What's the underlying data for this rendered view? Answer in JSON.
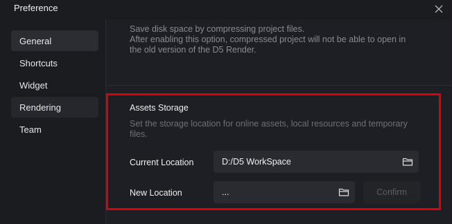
{
  "window": {
    "title": "Preference"
  },
  "sidebar": {
    "items": [
      {
        "label": "General"
      },
      {
        "label": "Shortcuts"
      },
      {
        "label": "Widget"
      },
      {
        "label": "Rendering"
      },
      {
        "label": "Team"
      }
    ]
  },
  "compression": {
    "desc_line1": "Save disk space by compressing project files.",
    "desc_line2": "After enabling this option, compressed project will not be able to open in",
    "desc_line3": "the old version of the D5 Render."
  },
  "assets_storage": {
    "title": "Assets Storage",
    "description": "Set the storage location for online assets, local resources and temporary files.",
    "current_location_label": "Current Location",
    "current_location_value": "D:/D5 WorkSpace",
    "new_location_label": "New Location",
    "new_location_value": "...",
    "confirm_label": "Confirm"
  },
  "colors": {
    "highlight": "#e0000a",
    "background": "#1e1f24",
    "sidebar_active": "#2c2d32"
  }
}
